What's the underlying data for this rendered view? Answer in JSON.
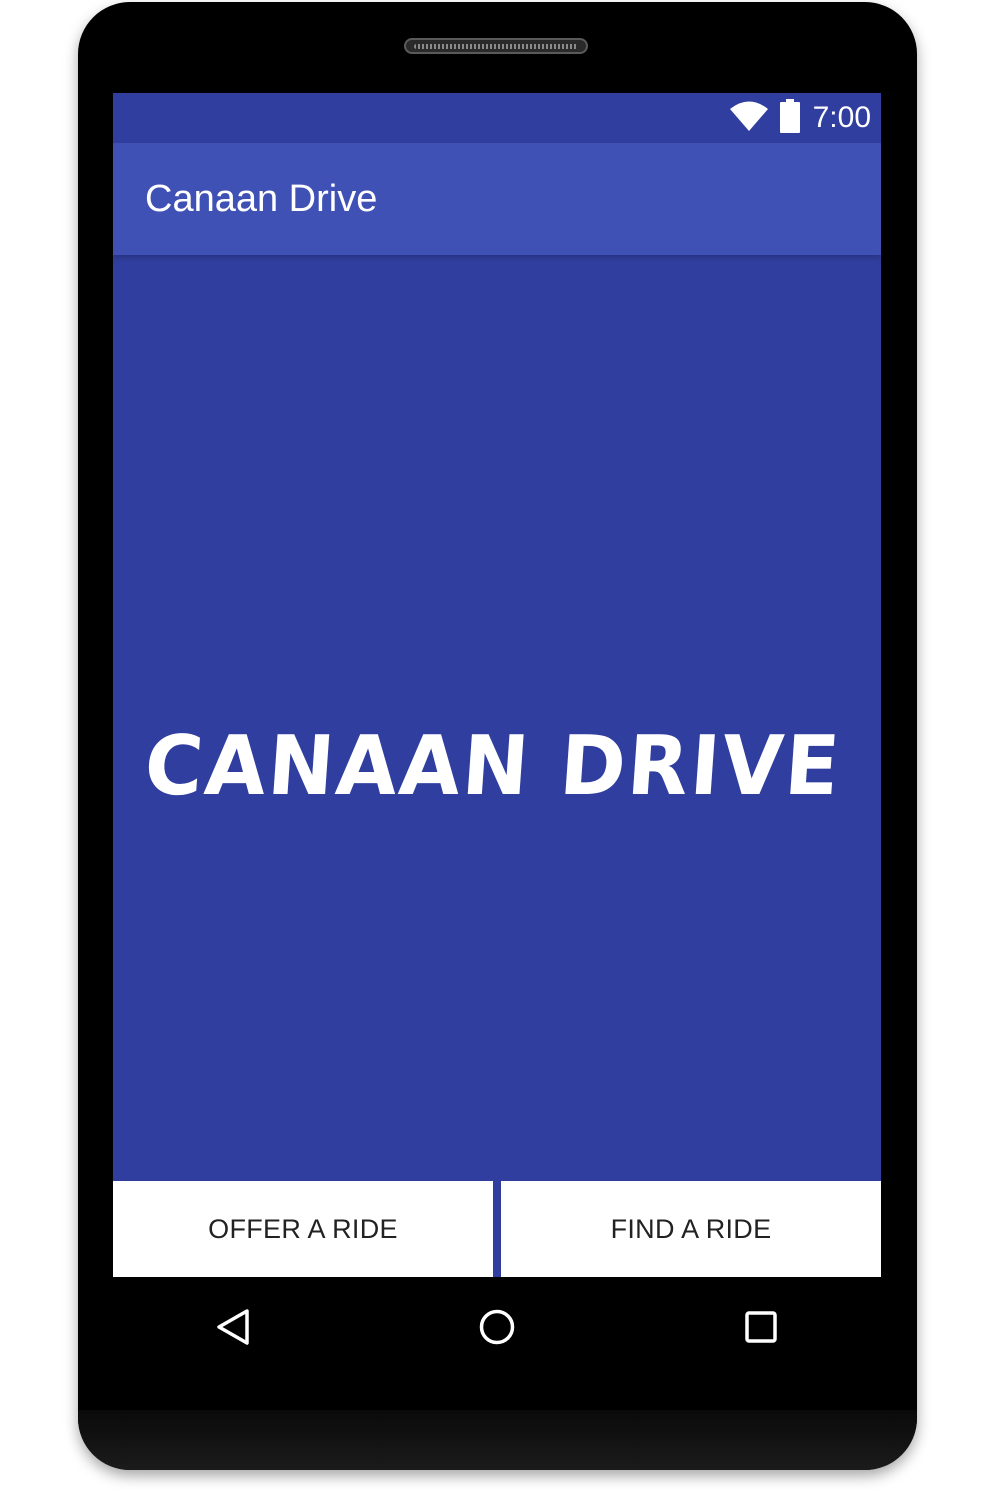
{
  "status_bar": {
    "time": "7:00",
    "icons": [
      "wifi-icon",
      "battery-icon"
    ]
  },
  "app_bar": {
    "title": "Canaan Drive"
  },
  "main": {
    "logo_text": "CANAAN DRIVE"
  },
  "buttons": {
    "offer_label": "OFFER A RIDE",
    "find_label": "FIND A RIDE"
  },
  "nav_bar": {
    "icons": [
      "back-icon",
      "home-icon",
      "recent-apps-icon"
    ]
  },
  "colors": {
    "primary_dark": "#303F9F",
    "primary": "#3F51B5",
    "button_bg": "#FFFFFF",
    "button_text": "#222222",
    "frame": "#000000"
  }
}
